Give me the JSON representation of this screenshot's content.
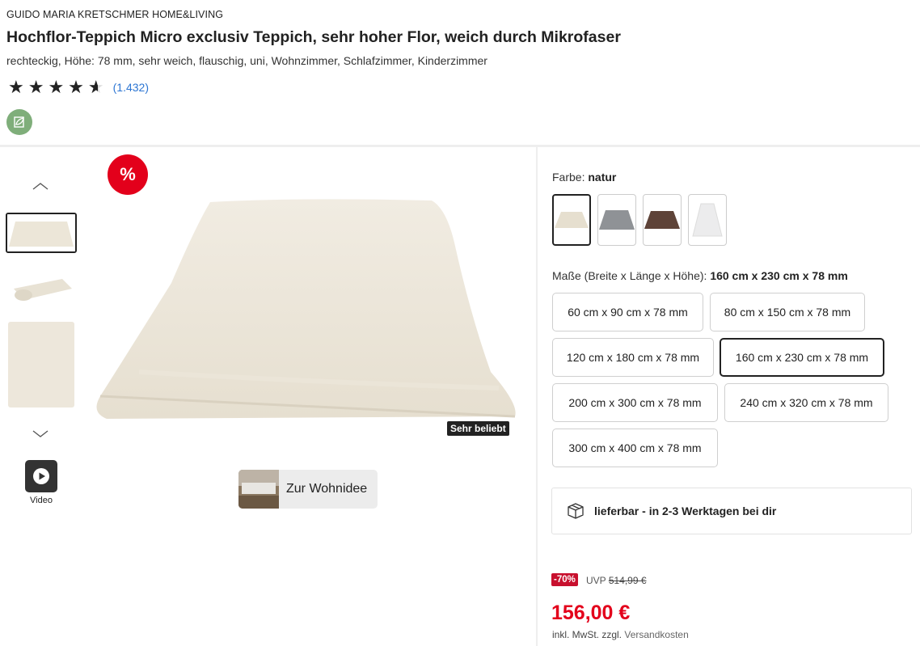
{
  "product": {
    "brand": "GUIDO MARIA KRETSCHMER HOME&LIVING",
    "title": "Hochflor-Teppich Micro exclusiv Teppich, sehr hoher Flor, weich durch Mikrofaser",
    "subtitle": "rechteckig, Höhe: 78 mm, sehr weich, flauschig, uni, Wohnzimmer, Schlafzimmer, Kinderzimmer",
    "rating": {
      "value": 4.5,
      "max": 5,
      "stars_glyphs": "★★★★★",
      "count": "(1.432)"
    },
    "eco_badge_icon": "leaf-document-icon"
  },
  "gallery": {
    "sale_badge": "%",
    "popular_tag": "Sehr beliebt",
    "wohnidee_label": "Zur Wohnidee",
    "video_label": "Video",
    "up_icon": "chevron-up-icon",
    "down_icon": "chevron-down-icon"
  },
  "variants": {
    "color_label": "Farbe:",
    "color_selected": "natur",
    "colors": [
      {
        "name": "natur",
        "hex": "#e9e2d4"
      },
      {
        "name": "grau",
        "hex": "#8f9296"
      },
      {
        "name": "braun",
        "hex": "#5e4338"
      },
      {
        "name": "weiß",
        "hex": "#ededee"
      }
    ],
    "size_label": "Maße (Breite x Länge x Höhe):",
    "size_selected": "160 cm x 230 cm x 78 mm",
    "sizes": [
      "60 cm x 90 cm x 78 mm",
      "80 cm x 150 cm x 78 mm",
      "120 cm x 180 cm x 78 mm",
      "160 cm x 230 cm x 78 mm",
      "200 cm x 300 cm x 78 mm",
      "240 cm x 320 cm x 78 mm",
      "300 cm x 400 cm x 78 mm"
    ]
  },
  "delivery": {
    "text": "lieferbar - in 2-3 Werktagen bei dir",
    "icon": "package-box-icon"
  },
  "pricing": {
    "discount": "-70%",
    "uvp_label": "UVP",
    "uvp_price": "514,99 €",
    "price": "156,00 €",
    "tax_text": "inkl. MwSt. zzgl.",
    "shipping_link": "Versandkosten"
  },
  "colors": {
    "sale_red": "#e3001b",
    "link_blue": "#2d76d3",
    "eco_green": "#7fae7a"
  }
}
